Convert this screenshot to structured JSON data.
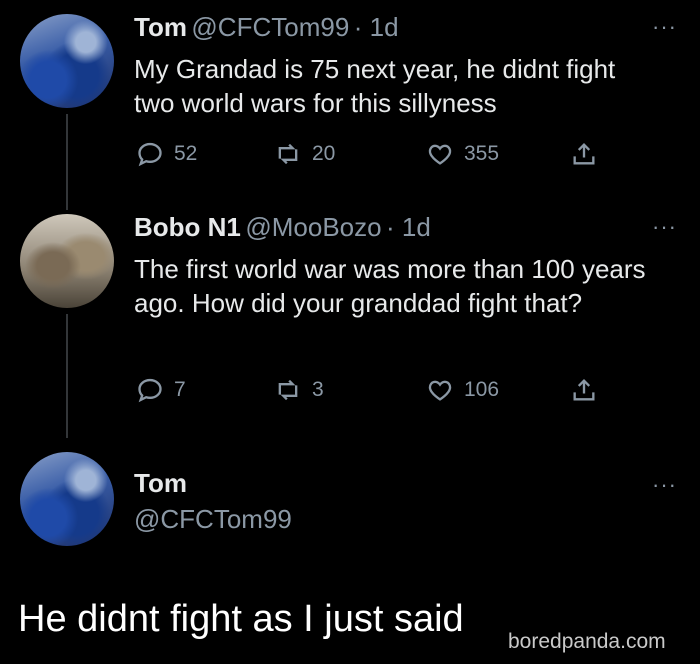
{
  "tweets": [
    {
      "name": "Tom",
      "handle": "@CFCTom99",
      "time": "· 1d",
      "text": "My Grandad is 75 next year,  he didnt fight two world wars for this sillyness",
      "replies": "52",
      "retweets": "20",
      "likes": "355"
    },
    {
      "name": "Bobo N1",
      "handle": "@MooBozo",
      "time": "· 1d",
      "text": "The first world war was more than 100 years ago. How did your granddad fight that?",
      "replies": "7",
      "retweets": "3",
      "likes": "106"
    }
  ],
  "profile": {
    "name": "Tom",
    "handle": "@CFCTom99"
  },
  "more_glyph": "···",
  "caption": "He didnt fight as I just said",
  "watermark": "boredpanda.com",
  "colors": {
    "background": "#000000",
    "text": "#e7e9ea",
    "muted": "#8b98a5"
  },
  "icons": [
    "reply-icon",
    "retweet-icon",
    "like-icon",
    "share-icon",
    "more-icon"
  ]
}
